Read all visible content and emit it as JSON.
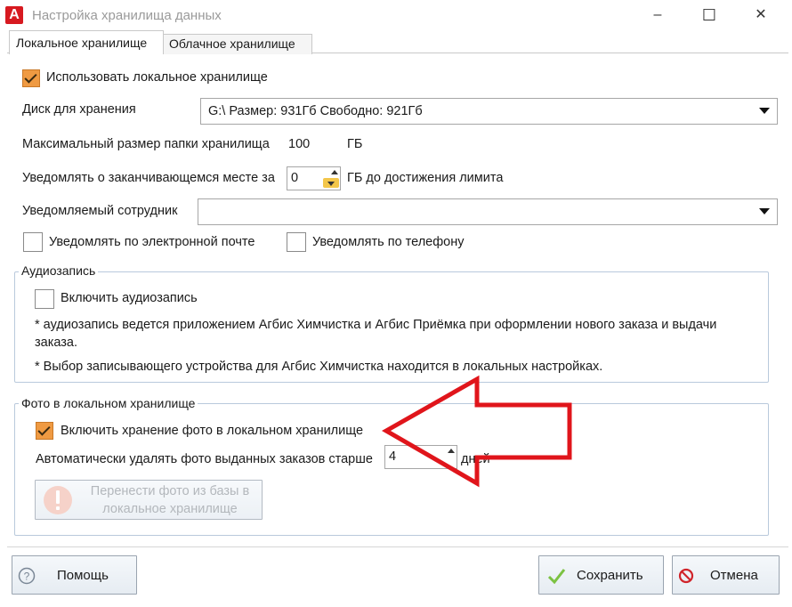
{
  "window": {
    "title": "Настройка хранилища данных",
    "controls": {
      "minimize": "–",
      "maximize": "☐",
      "close": "✕"
    }
  },
  "tabs": [
    {
      "label": "Локальное хранилище",
      "active": true
    },
    {
      "label": "Облачное хранилище",
      "active": false
    }
  ],
  "local": {
    "use_local_label": "Использовать локальное хранилище",
    "use_local_checked": true,
    "disk_label": "Диск для хранения",
    "disk_value": "G:\\ Размер: 931Гб Свободно: 921Гб",
    "max_size_label": "Максимальный размер папки хранилища",
    "max_size_value": "100",
    "max_size_unit": "ГБ",
    "notify_label": "Уведомлять о заканчивающемся месте за",
    "notify_value": "0",
    "notify_suffix": "ГБ до достижения лимита",
    "employee_label": "Уведомляемый сотрудник",
    "employee_value": "",
    "email_label": "Уведомлять по электронной почте",
    "phone_label": "Уведомлять по телефону"
  },
  "audio": {
    "legend": "Аудиозапись",
    "enable_label": "Включить аудиозапись",
    "note1": "* аудиозапись ведется приложением Агбис Химчистка и Агбис Приёмка при оформлении нового заказа и выдачи",
    "note1b": "заказа.",
    "note2": "* Выбор записывающего устройства для Агбис Химчистка находится в локальных настройках."
  },
  "photo": {
    "legend": "Фото в локальном хранилище",
    "enable_label": "Включить хранение фото в локальном хранилище",
    "enable_checked": true,
    "autodelete_label": "Автоматически удалять фото выданных заказов старше",
    "autodelete_value": "4",
    "autodelete_unit": "дней",
    "move_button_line1": "Перенести фото из базы в",
    "move_button_line2": "локальное хранилище"
  },
  "footer": {
    "help": "Помощь",
    "save": "Сохранить",
    "cancel": "Отмена"
  },
  "colors": {
    "checkbox_checked": "#ef9a42",
    "annotation_arrow": "#e0151b",
    "title_text": "#9a9a9a"
  }
}
